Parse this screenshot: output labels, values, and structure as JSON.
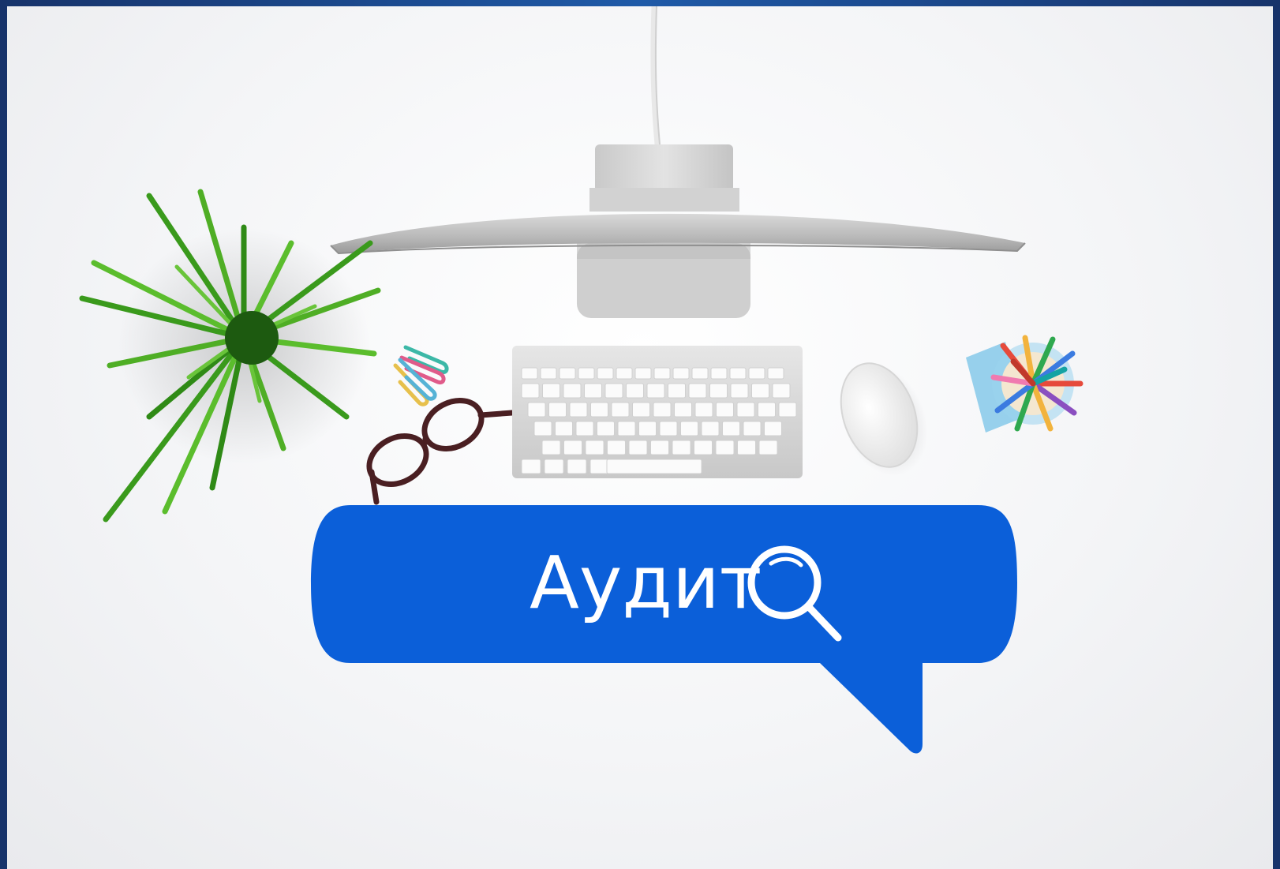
{
  "scene": {
    "description_label": "desk-flatlay",
    "bubble": {
      "text": "Аудит",
      "icon": "search-icon",
      "color": "#0b5fd9"
    },
    "frame_color": "#1a3f7a",
    "background_color": "#f3f4f6"
  }
}
